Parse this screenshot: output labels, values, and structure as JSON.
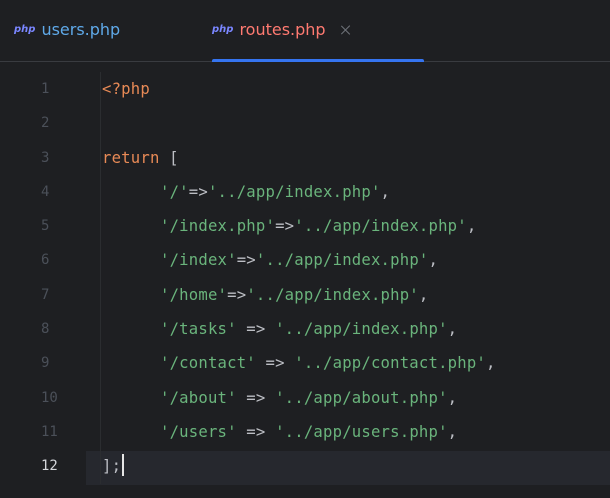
{
  "tabs": [
    {
      "badge": "php",
      "label": "users.php",
      "active": false
    },
    {
      "badge": "php",
      "label": "routes.php",
      "active": true
    }
  ],
  "colors": {
    "background": "#1e1f22",
    "accent": "#3574f0",
    "string": "#6ab47c",
    "keyword": "#e88a56",
    "inactive_tab_text": "#5fa9e9",
    "active_tab_text": "#ff7a71"
  },
  "editor": {
    "current_line": 12,
    "line_numbers": [
      "1",
      "2",
      "3",
      "4",
      "5",
      "6",
      "7",
      "8",
      "9",
      "10",
      "11",
      "12"
    ],
    "lines": [
      {
        "tokens": [
          {
            "t": "tag",
            "v": "<?php"
          }
        ]
      },
      {
        "tokens": []
      },
      {
        "tokens": [
          {
            "t": "kw",
            "v": "return"
          },
          {
            "t": "br",
            "v": " ["
          }
        ]
      },
      {
        "indent": true,
        "tokens": [
          {
            "t": "str",
            "v": "'/'"
          },
          {
            "t": "op",
            "v": "=>"
          },
          {
            "t": "str",
            "v": "'../app/index.php'"
          },
          {
            "t": "op",
            "v": ","
          }
        ]
      },
      {
        "indent": true,
        "tokens": [
          {
            "t": "str",
            "v": "'/index.php'"
          },
          {
            "t": "op",
            "v": "=>"
          },
          {
            "t": "str",
            "v": "'../app/index.php'"
          },
          {
            "t": "op",
            "v": ","
          }
        ]
      },
      {
        "indent": true,
        "tokens": [
          {
            "t": "str",
            "v": "'/index'"
          },
          {
            "t": "op",
            "v": "=>"
          },
          {
            "t": "str",
            "v": "'../app/index.php'"
          },
          {
            "t": "op",
            "v": ","
          }
        ]
      },
      {
        "indent": true,
        "tokens": [
          {
            "t": "str",
            "v": "'/home'"
          },
          {
            "t": "op",
            "v": "=>"
          },
          {
            "t": "str",
            "v": "'../app/index.php'"
          },
          {
            "t": "op",
            "v": ","
          }
        ]
      },
      {
        "indent": true,
        "tokens": [
          {
            "t": "str",
            "v": "'/tasks'"
          },
          {
            "t": "op",
            "v": " => "
          },
          {
            "t": "str",
            "v": "'../app/index.php'"
          },
          {
            "t": "op",
            "v": ","
          }
        ]
      },
      {
        "indent": true,
        "tokens": [
          {
            "t": "str",
            "v": "'/contact'"
          },
          {
            "t": "op",
            "v": " => "
          },
          {
            "t": "str",
            "v": "'../app/contact.php'"
          },
          {
            "t": "op",
            "v": ","
          }
        ]
      },
      {
        "indent": true,
        "tokens": [
          {
            "t": "str",
            "v": "'/about'"
          },
          {
            "t": "op",
            "v": " => "
          },
          {
            "t": "str",
            "v": "'../app/about.php'"
          },
          {
            "t": "op",
            "v": ","
          }
        ]
      },
      {
        "indent": true,
        "tokens": [
          {
            "t": "str",
            "v": "'/users'"
          },
          {
            "t": "op",
            "v": " => "
          },
          {
            "t": "str",
            "v": "'../app/users.php'"
          },
          {
            "t": "op",
            "v": ","
          }
        ]
      },
      {
        "tokens": [
          {
            "t": "br",
            "v": "];"
          }
        ],
        "caret": true
      }
    ]
  }
}
